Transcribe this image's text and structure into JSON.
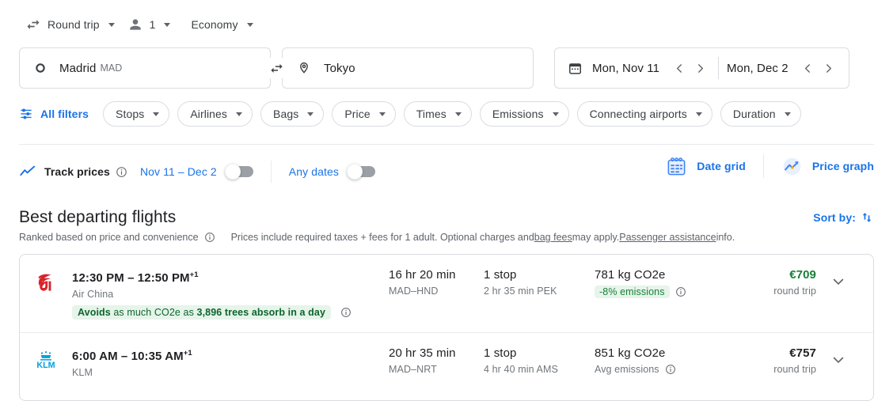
{
  "trip_options": [
    {
      "icon": "swap-horizontal-icon",
      "label": "Round trip",
      "caret": true
    },
    {
      "icon": "person-icon",
      "label": "1",
      "caret": true
    },
    {
      "icon": "none",
      "label": "Economy",
      "caret": true
    }
  ],
  "search": {
    "origin": {
      "icon": "circle-icon",
      "city": "Madrid",
      "code": "MAD"
    },
    "destination": {
      "icon": "location-pin-icon",
      "city": "Tokyo",
      "code": ""
    },
    "swap_icon": "swap-arrows-icon",
    "calendar_icon": "calendar-icon",
    "depart_date": "Mon, Nov 11",
    "return_date": "Mon, Dec 2"
  },
  "filters": {
    "all_filters_label": "All filters",
    "all_filters_icon": "tune-icon",
    "chips": [
      "Stops",
      "Airlines",
      "Bags",
      "Price",
      "Times",
      "Emissions",
      "Connecting airports",
      "Duration"
    ]
  },
  "track": {
    "icon": "trend-line-icon",
    "label": "Track prices",
    "info_icon": "info-icon",
    "date_range_label": "Nov 11 – Dec 2",
    "date_range_toggle_on": false,
    "any_dates_label": "Any dates",
    "any_dates_toggle_on": false,
    "date_grid_label": "Date grid",
    "date_grid_icon": "calendar-grid-icon",
    "price_graph_label": "Price graph",
    "price_graph_icon": "price-graph-icon"
  },
  "results": {
    "title": "Best departing flights",
    "ranked_text": "Ranked based on price and convenience",
    "ranked_info_icon": "info-icon",
    "prices_text_1": "Prices include required taxes + fees for 1 adult. Optional charges and ",
    "bag_fees_link": "bag fees",
    "prices_text_2": " may apply. ",
    "passenger_assistance_link": "Passenger assistance",
    "prices_text_3": " info.",
    "sort_by_label": "Sort by:",
    "sort_by_icon": "sort-arrows-icon",
    "flights": [
      {
        "logo": "air-china-logo",
        "logo_color": "#D8232A",
        "times": "12:30 PM – 12:50 PM",
        "next_day": "+1",
        "airline": "Air China",
        "duration": "16 hr 20 min",
        "route": "MAD–HND",
        "stops": "1 stop",
        "layover": "2 hr 35 min PEK",
        "co2": "781 kg CO2e",
        "emissions_badge": "-8% emissions",
        "emissions_is_badge": true,
        "emissions_info_icon": "info-icon",
        "price": "€709",
        "price_is_cheap": true,
        "price_type": "round trip",
        "eco_badge": {
          "bold_1": "Avoids",
          "mid": " as much CO2e as ",
          "bold_2": "3,896 trees absorb in a day",
          "info_icon": "info-icon"
        },
        "expand_icon": "chevron-down-icon"
      },
      {
        "logo": "klm-logo",
        "logo_color": "#00A1DE",
        "times": "6:00 AM – 10:35 AM",
        "next_day": "+1",
        "airline": "KLM",
        "duration": "20 hr 35 min",
        "route": "MAD–NRT",
        "stops": "1 stop",
        "layover": "4 hr 40 min AMS",
        "co2": "851 kg CO2e",
        "emissions_badge": "Avg emissions",
        "emissions_is_badge": false,
        "emissions_info_icon": "info-icon",
        "price": "€757",
        "price_is_cheap": false,
        "price_type": "round trip",
        "eco_badge": null,
        "expand_icon": "chevron-down-icon"
      }
    ]
  },
  "colors": {
    "accent_blue": "#1a73e8",
    "green": "#188038",
    "green_bg": "#e6f4ea",
    "border": "#dadce0",
    "text_secondary": "#70757a"
  }
}
